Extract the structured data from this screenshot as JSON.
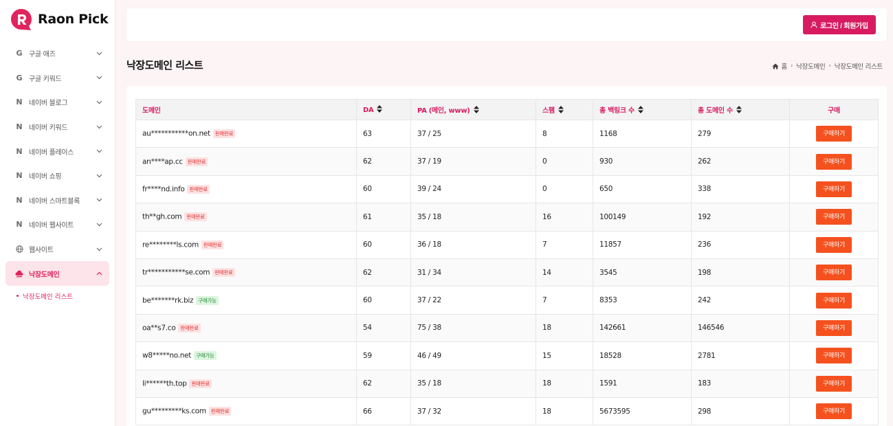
{
  "brand": {
    "name": "Raon Pick",
    "accent": "#d81b60"
  },
  "sidebar": {
    "items": [
      {
        "icon": "google-icon",
        "glyph": "G",
        "label": "구글 애즈",
        "active": false
      },
      {
        "icon": "google-icon",
        "glyph": "G",
        "label": "구글 키워드",
        "active": false
      },
      {
        "icon": "naver-icon",
        "glyph": "N",
        "label": "네이버 블로그",
        "active": false
      },
      {
        "icon": "naver-icon",
        "glyph": "N",
        "label": "네이버 키워드",
        "active": false
      },
      {
        "icon": "naver-icon",
        "glyph": "N",
        "label": "네이버 플레이스",
        "active": false
      },
      {
        "icon": "naver-icon",
        "glyph": "N",
        "label": "네이버 쇼핑",
        "active": false
      },
      {
        "icon": "naver-icon",
        "glyph": "N",
        "label": "네이버 스마트블록",
        "active": false
      },
      {
        "icon": "naver-icon",
        "glyph": "N",
        "label": "네이버 웹사이트",
        "active": false
      },
      {
        "icon": "globe-icon",
        "glyph": "",
        "label": "웹사이트",
        "active": false
      },
      {
        "icon": "cloud-icon",
        "glyph": "",
        "label": "낙장도메인",
        "active": true
      }
    ],
    "submenu": [
      {
        "label": "낙장도메인 리스트"
      }
    ]
  },
  "header": {
    "login_label": "로그인 / 회원가입"
  },
  "page": {
    "title": "낙장도메인 리스트",
    "breadcrumb": [
      "홈",
      "낙장도메인",
      "낙장도메인 리스트"
    ]
  },
  "table": {
    "columns": [
      "도메인",
      "DA",
      "PA (메인, www)",
      "스팸",
      "총 백링크 수",
      "총 도메인 수",
      "구매"
    ],
    "buy_label": "구매하기",
    "rows": [
      {
        "domain": "au***********on.net",
        "status": "판매완료",
        "da": "63",
        "pa": "37 / 25",
        "spam": "8",
        "backlinks": "1168",
        "domains": "279"
      },
      {
        "domain": "an****ap.cc",
        "status": "판매완료",
        "da": "62",
        "pa": "37 / 19",
        "spam": "0",
        "backlinks": "930",
        "domains": "262"
      },
      {
        "domain": "fr****nd.info",
        "status": "판매완료",
        "da": "60",
        "pa": "39 / 24",
        "spam": "0",
        "backlinks": "650",
        "domains": "338"
      },
      {
        "domain": "th**gh.com",
        "status": "판매완료",
        "da": "61",
        "pa": "35 / 18",
        "spam": "16",
        "backlinks": "100149",
        "domains": "192"
      },
      {
        "domain": "re********ls.com",
        "status": "판매완료",
        "da": "60",
        "pa": "36 / 18",
        "spam": "7",
        "backlinks": "11857",
        "domains": "236"
      },
      {
        "domain": "tr***********se.com",
        "status": "판매완료",
        "da": "62",
        "pa": "31 / 34",
        "spam": "14",
        "backlinks": "3545",
        "domains": "198"
      },
      {
        "domain": "be*******rk.biz",
        "status": "구매가능",
        "da": "60",
        "pa": "37 / 22",
        "spam": "7",
        "backlinks": "8353",
        "domains": "242"
      },
      {
        "domain": "oa**s7.co",
        "status": "판매완료",
        "da": "54",
        "pa": "75 / 38",
        "spam": "18",
        "backlinks": "142661",
        "domains": "146546"
      },
      {
        "domain": "w8*****no.net",
        "status": "구매가능",
        "da": "59",
        "pa": "46 / 49",
        "spam": "15",
        "backlinks": "18528",
        "domains": "2781"
      },
      {
        "domain": "li******th.top",
        "status": "판매완료",
        "da": "62",
        "pa": "35 / 18",
        "spam": "18",
        "backlinks": "1591",
        "domains": "183"
      },
      {
        "domain": "gu*********ks.com",
        "status": "판매완료",
        "da": "66",
        "pa": "37 / 32",
        "spam": "18",
        "backlinks": "5673595",
        "domains": "298"
      }
    ]
  }
}
